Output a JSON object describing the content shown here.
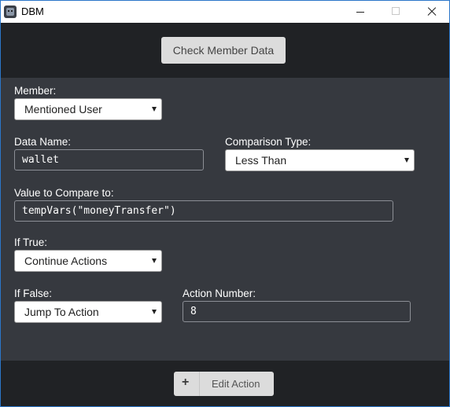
{
  "window": {
    "title": "DBM"
  },
  "header": {
    "check_button_label": "Check Member Data"
  },
  "form": {
    "member": {
      "label": "Member:",
      "selected": "Mentioned User"
    },
    "data_name": {
      "label": "Data Name:",
      "value": "wallet"
    },
    "comparison_type": {
      "label": "Comparison Type:",
      "selected": "Less Than"
    },
    "value_to_compare": {
      "label": "Value to Compare to:",
      "value": "tempVars(\"moneyTransfer\")"
    },
    "if_true": {
      "label": "If True:",
      "selected": "Continue Actions"
    },
    "if_false": {
      "label": "If False:",
      "selected": "Jump To Action"
    },
    "action_number": {
      "label": "Action Number:",
      "value": "8"
    }
  },
  "footer": {
    "edit_button_icon": "+",
    "edit_button_label": "Edit Action"
  },
  "icons": {
    "app": "dbm-app-icon",
    "minimize": "minimize-icon",
    "maximize": "maximize-icon",
    "close": "close-icon",
    "dropdown": "chevron-down-icon",
    "add": "plus-icon"
  },
  "colors": {
    "header_bg": "#202225",
    "form_bg": "#36393f",
    "button_bg": "#dcdcdc",
    "window_border": "#2b76c9"
  }
}
